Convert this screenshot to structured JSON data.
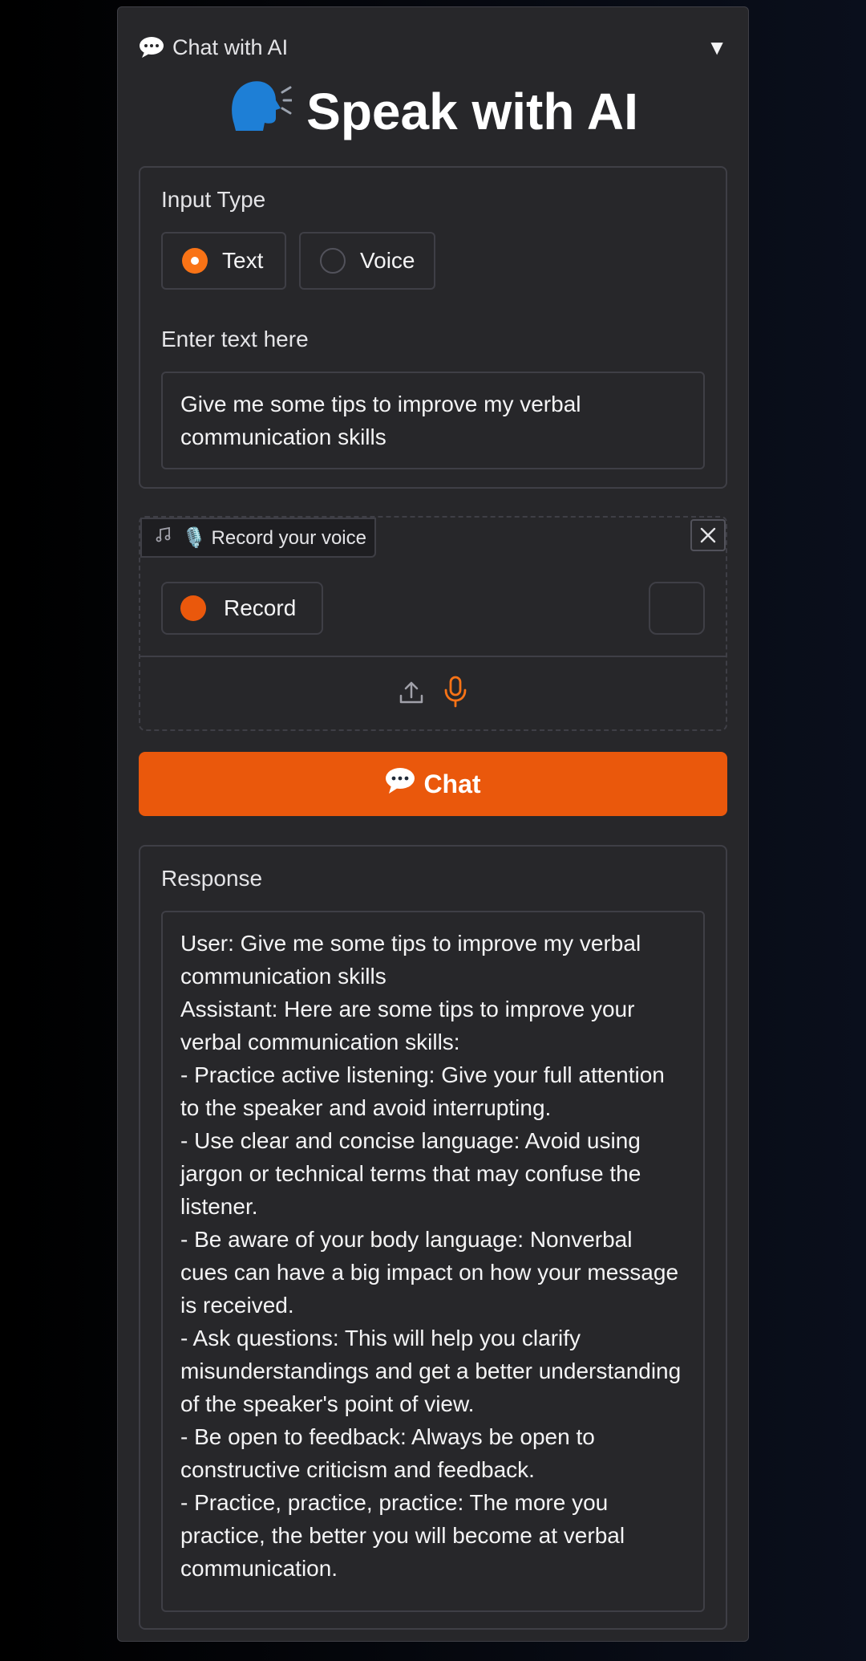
{
  "header": {
    "label": "Chat with AI",
    "icon": "speech-bubble-icon",
    "toggle": "▼"
  },
  "title": {
    "icon": "speaking-head-icon",
    "text": "Speak with AI"
  },
  "input_type": {
    "label": "Input Type",
    "options": [
      {
        "label": "Text",
        "selected": true
      },
      {
        "label": "Voice",
        "selected": false
      }
    ]
  },
  "text_input": {
    "label": "Enter text here",
    "value": "Give me some tips to improve my verbal communication skills"
  },
  "audio": {
    "tag_label": "🎙️ Record your voice",
    "record_label": "Record"
  },
  "chat_button": {
    "label": "Chat"
  },
  "response": {
    "label": "Response",
    "value": "User: Give me some tips to improve my verbal communication skills\nAssistant: Here are some tips to improve your verbal communication skills:\n- Practice active listening: Give your full attention to the speaker and avoid interrupting.\n- Use clear and concise language: Avoid using jargon or technical terms that may confuse the listener.\n- Be aware of your body language: Nonverbal cues can have a big impact on how your message is received.\n- Ask questions: This will help you clarify misunderstandings and get a better understanding of the speaker's point of view.\n- Be open to feedback: Always be open to constructive criticism and feedback.\n- Practice, practice, practice: The more you practice, the better you will become at verbal communication."
  },
  "colors": {
    "accent": "#ea580c",
    "panel": "#27272a",
    "border": "#3f3f46"
  }
}
